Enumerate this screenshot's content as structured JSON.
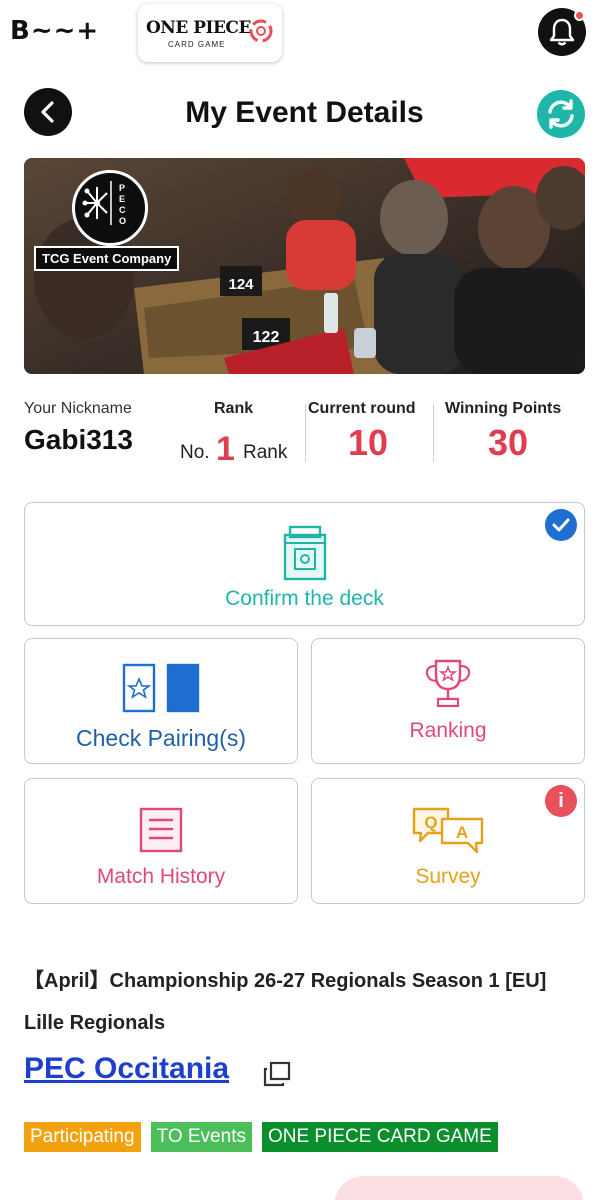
{
  "topbar": {
    "brand": "B~~+",
    "game_logo_line1": "ONE PIECE",
    "game_logo_line2": "CARD GAME"
  },
  "header": {
    "title": "My Event Details"
  },
  "banner": {
    "organizer_badge": "PECO",
    "organizer_label": "TCG Event Company",
    "table_numbers": [
      "124",
      "122"
    ]
  },
  "stats": {
    "nickname_label": "Your Nickname",
    "nickname": "Gabi313",
    "rank_label": "Rank",
    "rank_prefix": "No.",
    "rank_value": "1",
    "rank_suffix": "Rank",
    "round_label": "Current round",
    "round_value": "10",
    "points_label": "Winning Points",
    "points_value": "30"
  },
  "actions": {
    "confirm_deck": "Confirm the deck",
    "check_pairings": "Check Pairing(s)",
    "ranking": "Ranking",
    "match_history": "Match History",
    "survey": "Survey",
    "survey_badge": "i"
  },
  "event": {
    "title": "【April】Championship 26-27 Regionals Season 1 [EU] Lille Regionals",
    "venue": "PEC Occitania",
    "tags": [
      "Participating",
      "TO Events",
      "ONE PIECE CARD GAME"
    ]
  },
  "colors": {
    "accent_red": "#e03c52",
    "teal": "#1fb6aa",
    "blue": "#1f6fd1",
    "pink": "#e0487a",
    "gold": "#e6a11a",
    "link": "#1f3fd1"
  }
}
